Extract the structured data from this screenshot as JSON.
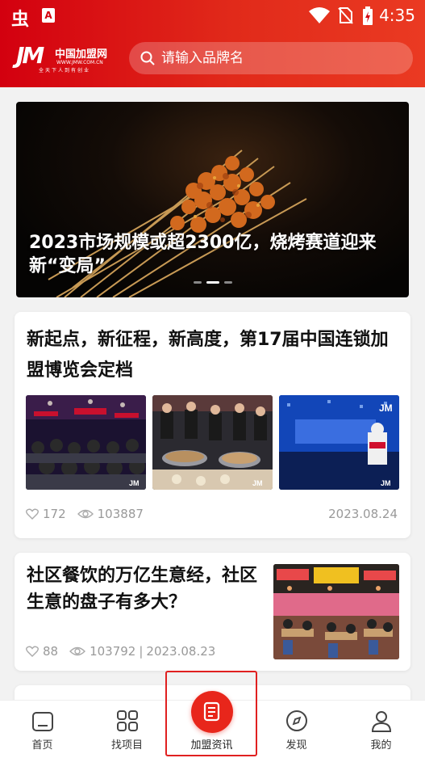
{
  "status_bar": {
    "app_icon_1": "虫",
    "app_icon_2": "A",
    "time": "4:35",
    "icons": [
      "wifi-icon",
      "no-sim-icon",
      "battery-charging-icon"
    ]
  },
  "header": {
    "logo": {
      "mark": "JM",
      "name": "中国加盟网",
      "url": "WWW.JMW.COM.CN",
      "slogan": "全天下人到有创业"
    },
    "search": {
      "placeholder": "请输入品牌名",
      "icon": "search-icon"
    },
    "colors": {
      "brand": "#d3000f",
      "brand_light": "#ea3a22"
    }
  },
  "banner": {
    "title": "2023市场规模或超2300亿，烧烤赛道迎来新“变局”",
    "slides": 3,
    "active_slide": 2
  },
  "articles": [
    {
      "title": "新起点，新征程，新高度，第17届中国连锁加盟博览会定档",
      "likes": "172",
      "views": "103887",
      "date": "2023.08.24",
      "images": [
        "expo-audience-photo",
        "cooking-demo-photo",
        "expo-stage-photo"
      ]
    },
    {
      "title": "社区餐饮的万亿生意经，社区生意的盘子有多大？",
      "likes": "88",
      "views": "103792",
      "separator": "|",
      "date": "2023.08.23",
      "images": [
        "food-court-photo"
      ]
    }
  ],
  "tabbar": {
    "items": [
      {
        "label": "首页",
        "icon": "home-icon"
      },
      {
        "label": "找项目",
        "icon": "grid-icon"
      },
      {
        "label": "加盟资讯",
        "icon": "news-icon",
        "active": true
      },
      {
        "label": "发现",
        "icon": "compass-icon"
      },
      {
        "label": "我的",
        "icon": "user-icon"
      }
    ],
    "active_color": "#e8261b"
  }
}
